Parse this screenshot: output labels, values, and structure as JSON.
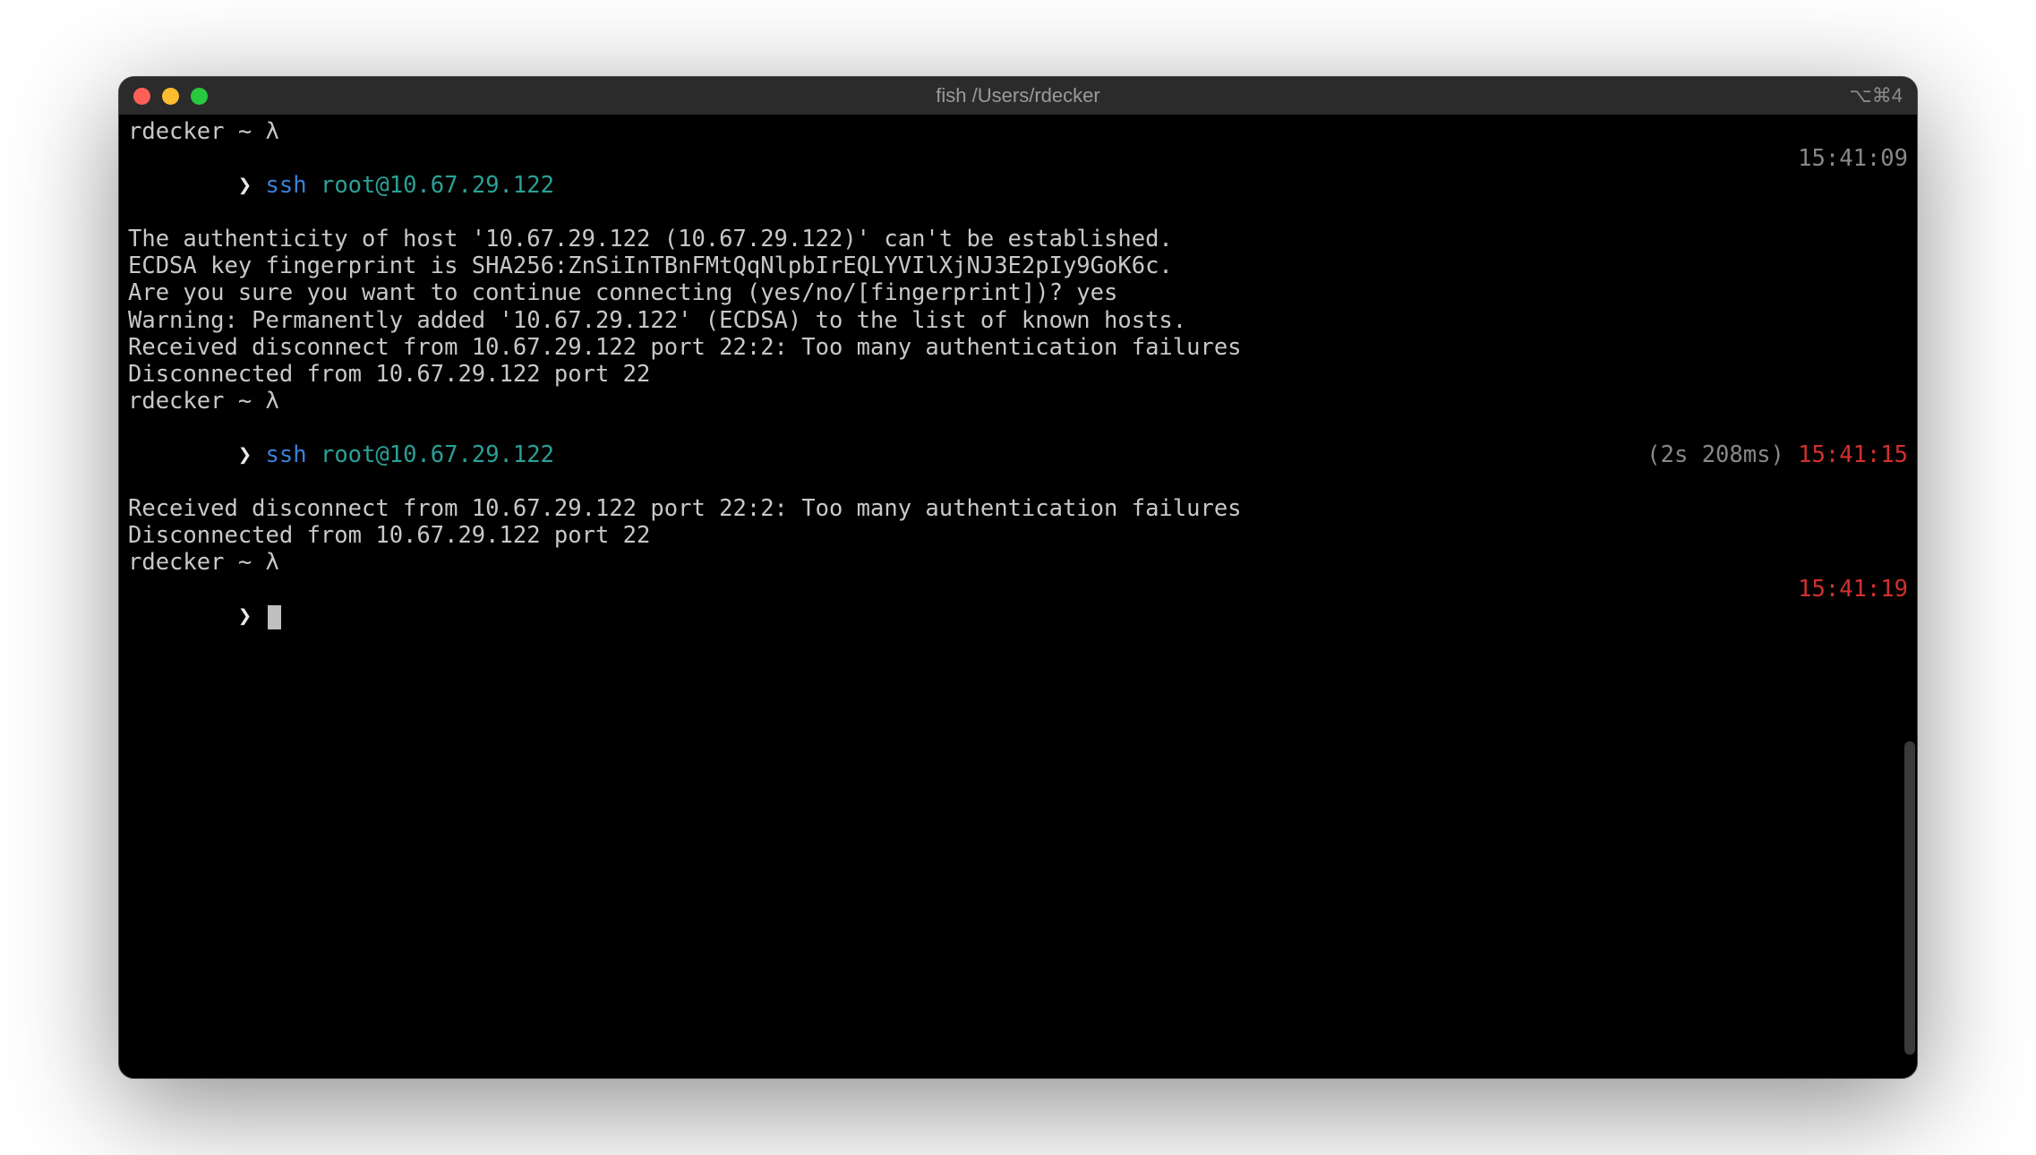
{
  "titlebar": {
    "title": "fish /Users/rdecker",
    "right_hint": "⌥⌘4"
  },
  "colors": {
    "close": "#ff5f57",
    "minimize": "#febc2e",
    "zoom": "#28c840"
  },
  "prompt1": {
    "header": "rdecker ~ λ",
    "glyph": "❯",
    "cmd_part1": "ssh",
    "cmd_part2": "root@10.67.29.122",
    "timestamp": "15:41:09"
  },
  "out1": {
    "l1": "The authenticity of host '10.67.29.122 (10.67.29.122)' can't be established.",
    "l2": "ECDSA key fingerprint is SHA256:ZnSiInTBnFMtQqNlpbIrEQLYVIlXjNJ3E2pIy9GoK6c.",
    "l3": "Are you sure you want to continue connecting (yes/no/[fingerprint])? yes",
    "l4": "Warning: Permanently added '10.67.29.122' (ECDSA) to the list of known hosts.",
    "l5": "Received disconnect from 10.67.29.122 port 22:2: Too many authentication failures",
    "l6": "Disconnected from 10.67.29.122 port 22"
  },
  "prompt2": {
    "header": "rdecker ~ λ",
    "glyph": "❯",
    "cmd_part1": "ssh",
    "cmd_part2": "root@10.67.29.122",
    "duration": "(2s 208ms) ",
    "timestamp": "15:41:15"
  },
  "out2": {
    "l1": "Received disconnect from 10.67.29.122 port 22:2: Too many authentication failures",
    "l2": "Disconnected from 10.67.29.122 port 22"
  },
  "prompt3": {
    "header": "rdecker ~ λ",
    "glyph": "❯",
    "timestamp": "15:41:19"
  }
}
